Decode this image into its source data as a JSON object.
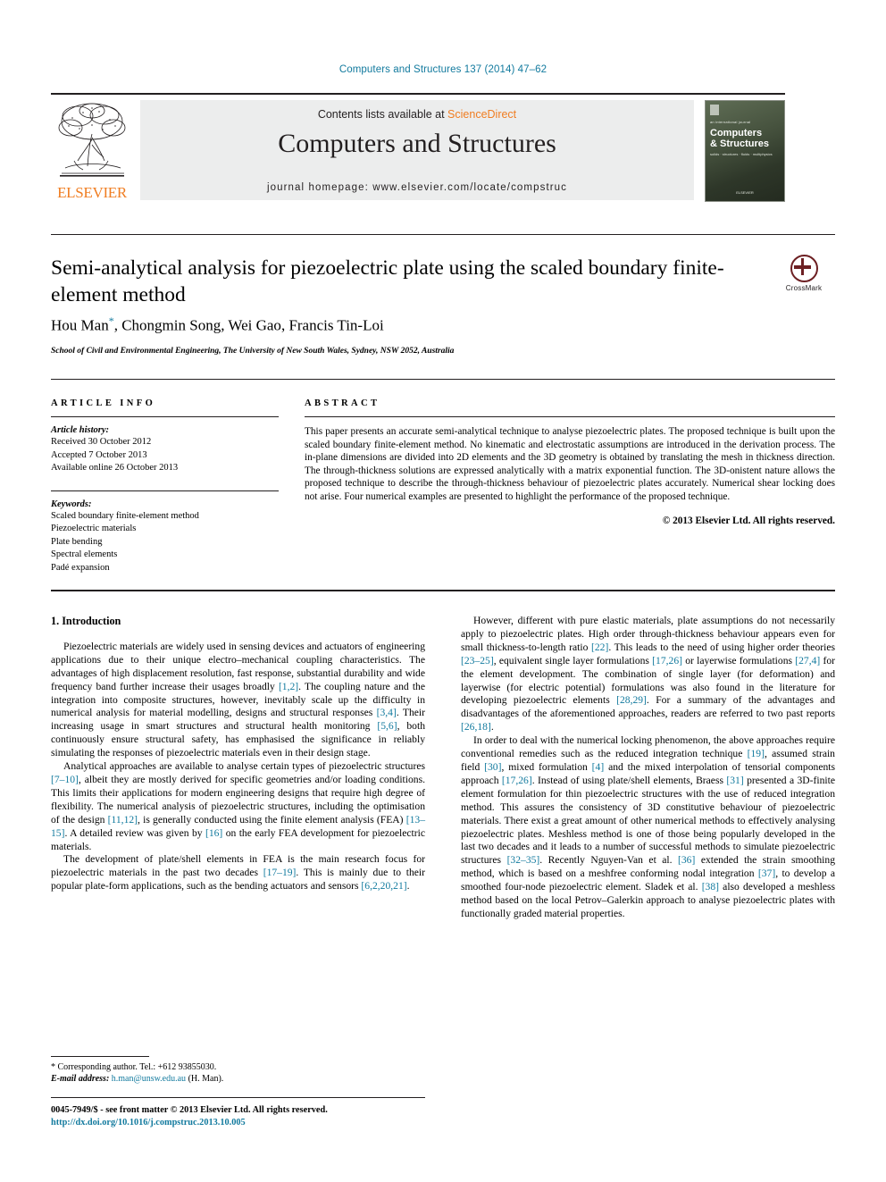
{
  "running_head": "Computers and Structures 137 (2014) 47–62",
  "masthead": {
    "contents_prefix": "Contents lists available at ",
    "sciencedirect": "ScienceDirect",
    "journal_name": "Computers and Structures",
    "homepage": "journal homepage: www.elsevier.com/locate/compstruc",
    "publisher_wordmark": "ELSEVIER",
    "cover": {
      "subtitle": "an international journal",
      "title_line1": "Computers",
      "title_line2": "& Structures",
      "strapline": "solids · structures · fluids · multiphysics",
      "footer": "ELSEVIER"
    }
  },
  "article": {
    "title": "Semi-analytical analysis for piezoelectric plate using the scaled boundary finite-element method",
    "authors": "Hou Man , Chongmin Song, Wei Gao, Francis Tin-Loi",
    "author_names": [
      "Hou Man",
      "Chongmin Song",
      "Wei Gao",
      "Francis Tin-Loi"
    ],
    "corresponding_marker": "*",
    "affiliation": "School of Civil and Environmental Engineering, The University of New South Wales, Sydney, NSW 2052, Australia",
    "crossmark_label": "CrossMark"
  },
  "article_info": {
    "heading": "ARTICLE INFO",
    "history_label": "Article history:",
    "history": [
      "Received 30 October 2012",
      "Accepted 7 October 2013",
      "Available online 26 October 2013"
    ],
    "keywords_label": "Keywords:",
    "keywords": [
      "Scaled boundary finite-element method",
      "Piezoelectric materials",
      "Plate bending",
      "Spectral elements",
      "Padé expansion"
    ]
  },
  "abstract": {
    "heading": "ABSTRACT",
    "text": "This paper presents an accurate semi-analytical technique to analyse piezoelectric plates. The proposed technique is built upon the scaled boundary finite-element method. No kinematic and electrostatic assumptions are introduced in the derivation process. The in-plane dimensions are divided into 2D elements and the 3D geometry is obtained by translating the mesh in thickness direction. The through-thickness solutions are expressed analytically with a matrix exponential function. The 3D-onistent nature allows the proposed technique to describe the through-thickness behaviour of piezoelectric plates accurately. Numerical shear locking does not arise. Four numerical examples are presented to highlight the performance of the proposed technique.",
    "copyright": "© 2013 Elsevier Ltd. All rights reserved."
  },
  "body": {
    "section_heading": "1. Introduction",
    "left_paragraphs": [
      "Piezoelectric materials are widely used in sensing devices and actuators of engineering applications due to their unique electro–mechanical coupling characteristics. The advantages of high displacement resolution, fast response, substantial durability and wide frequency band further increase their usages broadly [1,2]. The coupling nature and the integration into composite structures, however, inevitably scale up the difficulty in numerical analysis for material modelling, designs and structural responses [3,4]. Their increasing usage in smart structures and structural health monitoring [5,6], both continuously ensure structural safety, has emphasised the significance in reliably simulating the responses of piezoelectric materials even in their design stage.",
      "Analytical approaches are available to analyse certain types of piezoelectric structures [7–10], albeit they are mostly derived for specific geometries and/or loading conditions. This limits their applications for modern engineering designs that require high degree of flexibility. The numerical analysis of piezoelectric structures, including the optimisation of the design [11,12], is generally conducted using the finite element analysis (FEA) [13–15]. A detailed review was given by [16] on the early FEA development for piezoelectric materials.",
      "The development of plate/shell elements in FEA is the main research focus for piezoelectric materials in the past two decades [17–19]. This is mainly due to their popular plate-form applications, such as the bending actuators and sensors [6,2,20,21]."
    ],
    "right_paragraphs": [
      "However, different with pure elastic materials, plate assumptions do not necessarily apply to piezoelectric plates. High order through-thickness behaviour appears even for small thickness-to-length ratio [22]. This leads to the need of using higher order theories [23–25], equivalent single layer formulations [17,26] or layerwise formulations [27,4] for the element development. The combination of single layer (for deformation) and layerwise (for electric potential) formulations was also found in the literature for developing piezoelectric elements [28,29]. For a summary of the advantages and disadvantages of the aforementioned approaches, readers are referred to two past reports [26,18].",
      "In order to deal with the numerical locking phenomenon, the above approaches require conventional remedies such as the reduced integration technique [19], assumed strain field [30], mixed formulation [4] and the mixed interpolation of tensorial components approach [17,26]. Instead of using plate/shell elements, Braess [31] presented a 3D-finite element formulation for thin piezoelectric structures with the use of reduced integration method. This assures the consistency of 3D constitutive behaviour of piezoelectric materials. There exist a great amount of other numerical methods to effectively analysing piezoelectric plates. Meshless method is one of those being popularly developed in the last two decades and it leads to a number of successful methods to simulate piezoelectric structures [32–35]. Recently Nguyen-Van et al. [36] extended the strain smoothing method, which is based on a meshfree conforming nodal integration [37], to develop a smoothed four-node piezoelectric element. Sladek et al. [38] also developed a meshless method based on the local Petrov–Galerkin approach to analyse piezoelectric plates with functionally graded material properties."
    ]
  },
  "footnotes": {
    "corresponding": "* Corresponding author. Tel.: +612 93855030.",
    "email_label": "E-mail address:",
    "email": "h.man@unsw.edu.au",
    "email_suffix": "(H. Man)."
  },
  "footer": {
    "issn_line": "0045-7949/$ - see front matter © 2013 Elsevier Ltd. All rights reserved.",
    "doi": "http://dx.doi.org/10.1016/j.compstruc.2013.10.005"
  },
  "colors": {
    "link": "#127a9e",
    "elsevier_orange": "#f07d21",
    "crossmark_red": "#6d2023"
  }
}
